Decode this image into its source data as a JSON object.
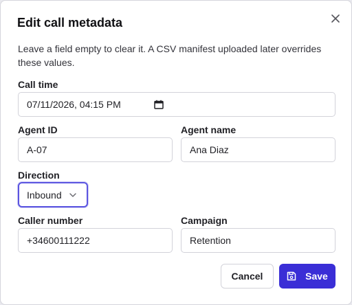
{
  "dialog": {
    "title": "Edit call metadata",
    "description": "Leave a field empty to clear it. A CSV manifest uploaded later overrides these values.",
    "close_icon": "close-icon"
  },
  "fields": {
    "call_time": {
      "label": "Call time",
      "value": "07/11/2026, 04:15 PM",
      "icon": "calendar-icon"
    },
    "agent_id": {
      "label": "Agent ID",
      "value": "A-07"
    },
    "agent_name": {
      "label": "Agent name",
      "value": "Ana Diaz"
    },
    "direction": {
      "label": "Direction",
      "value": "Inbound",
      "icon": "chevron-down-icon"
    },
    "caller_number": {
      "label": "Caller number",
      "value": "+34600111222"
    },
    "campaign": {
      "label": "Campaign",
      "value": "Retention"
    }
  },
  "actions": {
    "cancel_label": "Cancel",
    "save_label": "Save",
    "save_icon": "save-icon"
  },
  "colors": {
    "accent": "#3a2ed6",
    "focus_ring": "#5b55e0"
  }
}
